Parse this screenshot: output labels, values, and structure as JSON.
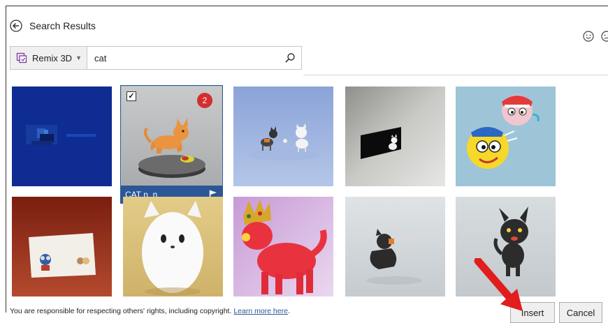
{
  "header": {
    "title": "Search Results"
  },
  "search": {
    "source_label": "Remix 3D",
    "query": "cat"
  },
  "results": {
    "selected": {
      "caption": "CAT n_n",
      "badge": "2",
      "checkmark": "✓"
    },
    "tiles": [
      {
        "name": "dark-blue-scene"
      },
      {
        "name": "orange-cat-on-platform"
      },
      {
        "name": "two-cats-blue"
      },
      {
        "name": "cat-with-black-panel"
      },
      {
        "name": "emoji-faces"
      },
      {
        "name": "red-box-with-figures"
      },
      {
        "name": "white-round-cat"
      },
      {
        "name": "red-cat-with-crown"
      },
      {
        "name": "cat-with-knife"
      },
      {
        "name": "black-cat-standing"
      }
    ]
  },
  "footer": {
    "notice": "You are responsible for respecting others' rights, including copyright.",
    "learn_more": "Learn more here",
    "period": "."
  },
  "buttons": {
    "insert": "Insert",
    "cancel": "Cancel"
  },
  "colors": {
    "accent": "#2b5797",
    "badge": "#d32f2f",
    "annotation_arrow": "#e11d1d"
  }
}
